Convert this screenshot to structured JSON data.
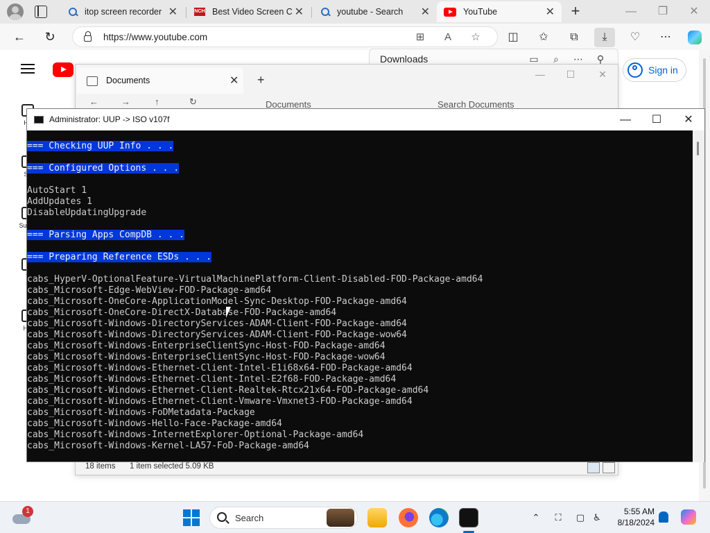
{
  "browser": {
    "tabs": [
      {
        "title": "itop screen recorder",
        "favicon": "search-favicon"
      },
      {
        "title": "Best Video Screen Ca",
        "favicon": "nch-favicon"
      },
      {
        "title": "youtube - Search",
        "favicon": "search-favicon"
      },
      {
        "title": "YouTube",
        "favicon": "youtube-favicon",
        "active": true
      }
    ],
    "new_tab": "+",
    "window_controls": {
      "minimize": "—",
      "maximize": "❐",
      "close": "✕"
    },
    "address": "https://www.youtube.com",
    "back": "←",
    "refresh": "↻"
  },
  "youtube": {
    "sign_in": "Sign in",
    "sidebar": [
      "Ho",
      "Sh",
      "Subsc",
      "Y",
      "His"
    ]
  },
  "downloads": {
    "title": "Downloads"
  },
  "explorer": {
    "tab_title": "Documents",
    "nav_path": "Documents",
    "nav_search": "Search Documents",
    "status_items": "18 items",
    "status_selected": "1 item selected  5.09 KB"
  },
  "console": {
    "title": "Administrator:  UUP -> ISO v107f",
    "lines": [
      {
        "text": "=== Checking UUP Info . . .",
        "highlight": true
      },
      {
        "text": "",
        "highlight": false
      },
      {
        "text": "=== Configured Options . . .",
        "highlight": true
      },
      {
        "text": "",
        "highlight": false
      },
      {
        "text": "AutoStart 1",
        "highlight": false
      },
      {
        "text": "AddUpdates 1",
        "highlight": false
      },
      {
        "text": "DisableUpdatingUpgrade",
        "highlight": false
      },
      {
        "text": "",
        "highlight": false
      },
      {
        "text": "=== Parsing Apps CompDB . . .",
        "highlight": true
      },
      {
        "text": "",
        "highlight": false
      },
      {
        "text": "=== Preparing Reference ESDs . . .",
        "highlight": true
      },
      {
        "text": "",
        "highlight": false
      },
      {
        "text": "cabs_HyperV-OptionalFeature-VirtualMachinePlatform-Client-Disabled-FOD-Package-amd64",
        "highlight": false
      },
      {
        "text": "cabs_Microsoft-Edge-WebView-FOD-Package-amd64",
        "highlight": false
      },
      {
        "text": "cabs_Microsoft-OneCore-ApplicationModel-Sync-Desktop-FOD-Package-amd64",
        "highlight": false
      },
      {
        "text": "cabs_Microsoft-OneCore-DirectX-Database-FOD-Package-amd64",
        "highlight": false
      },
      {
        "text": "cabs_Microsoft-Windows-DirectoryServices-ADAM-Client-FOD-Package-amd64",
        "highlight": false
      },
      {
        "text": "cabs_Microsoft-Windows-DirectoryServices-ADAM-Client-FOD-Package-wow64",
        "highlight": false
      },
      {
        "text": "cabs_Microsoft-Windows-EnterpriseClientSync-Host-FOD-Package-amd64",
        "highlight": false
      },
      {
        "text": "cabs_Microsoft-Windows-EnterpriseClientSync-Host-FOD-Package-wow64",
        "highlight": false
      },
      {
        "text": "cabs_Microsoft-Windows-Ethernet-Client-Intel-E1i68x64-FOD-Package-amd64",
        "highlight": false
      },
      {
        "text": "cabs_Microsoft-Windows-Ethernet-Client-Intel-E2f68-FOD-Package-amd64",
        "highlight": false
      },
      {
        "text": "cabs_Microsoft-Windows-Ethernet-Client-Realtek-Rtcx21x64-FOD-Package-amd64",
        "highlight": false
      },
      {
        "text": "cabs_Microsoft-Windows-Ethernet-Client-Vmware-Vmxnet3-FOD-Package-amd64",
        "highlight": false
      },
      {
        "text": "cabs_Microsoft-Windows-FoDMetadata-Package",
        "highlight": false
      },
      {
        "text": "cabs_Microsoft-Windows-Hello-Face-Package-amd64",
        "highlight": false
      },
      {
        "text": "cabs_Microsoft-Windows-InternetExplorer-Optional-Package-amd64",
        "highlight": false
      },
      {
        "text": "cabs_Microsoft-Windows-Kernel-LA57-FoD-Package-amd64",
        "highlight": false
      }
    ],
    "highlight_color": "#0037da",
    "text_color": "#cccccc",
    "background": "#0c0c0c"
  },
  "taskbar": {
    "search": "Search",
    "weather_badge": "1",
    "time": "5:55 AM",
    "date": "8/18/2024",
    "apps": [
      "file-explorer",
      "firefox",
      "edge",
      "terminal"
    ],
    "accent": "#0078d4"
  }
}
